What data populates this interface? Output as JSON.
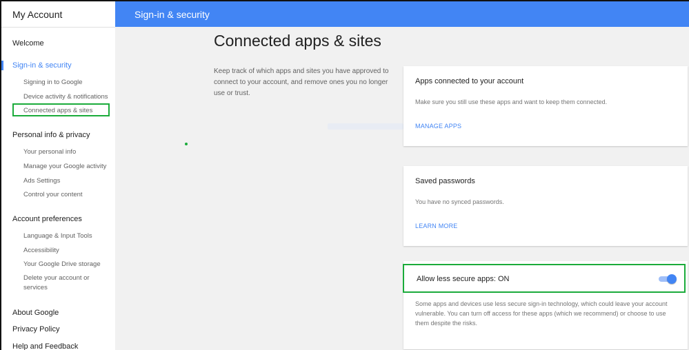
{
  "sidebar": {
    "title": "My Account",
    "sections": [
      {
        "label": "Welcome",
        "items": []
      },
      {
        "label": "Sign-in & security",
        "items": [
          "Signing in to Google",
          "Device activity & notifications",
          "Connected apps & sites"
        ]
      },
      {
        "label": "Personal info & privacy",
        "items": [
          "Your personal info",
          "Manage your Google activity",
          "Ads Settings",
          "Control your content"
        ]
      },
      {
        "label": "Account preferences",
        "items": [
          "Language & Input Tools",
          "Accessibility",
          "Your Google Drive storage",
          "Delete your account or services"
        ]
      },
      {
        "label": "About Google",
        "items": []
      },
      {
        "label": "Privacy Policy",
        "items": []
      },
      {
        "label": "Help and Feedback",
        "items": []
      }
    ]
  },
  "header": {
    "title": "Sign-in & security"
  },
  "main": {
    "title": "Connected apps & sites",
    "description": "Keep track of which apps and sites you have approved to connect to your account, and remove ones you no longer use or trust.",
    "cards": [
      {
        "title": "Apps connected to your account",
        "text": "Make sure you still use these apps and want to keep them connected.",
        "link": "MANAGE APPS"
      },
      {
        "title": "Saved passwords",
        "text": "You have no synced passwords.",
        "link": "LEARN MORE"
      }
    ],
    "less_secure": {
      "label": "Allow less secure apps: ON",
      "description": "Some apps and devices use less secure sign-in technology, which could leave your account vulnerable. You can turn off access for these apps (which we recommend) or choose to use them despite the risks."
    }
  },
  "colors": {
    "accent": "#4285f4",
    "highlight": "#1aab3a"
  }
}
